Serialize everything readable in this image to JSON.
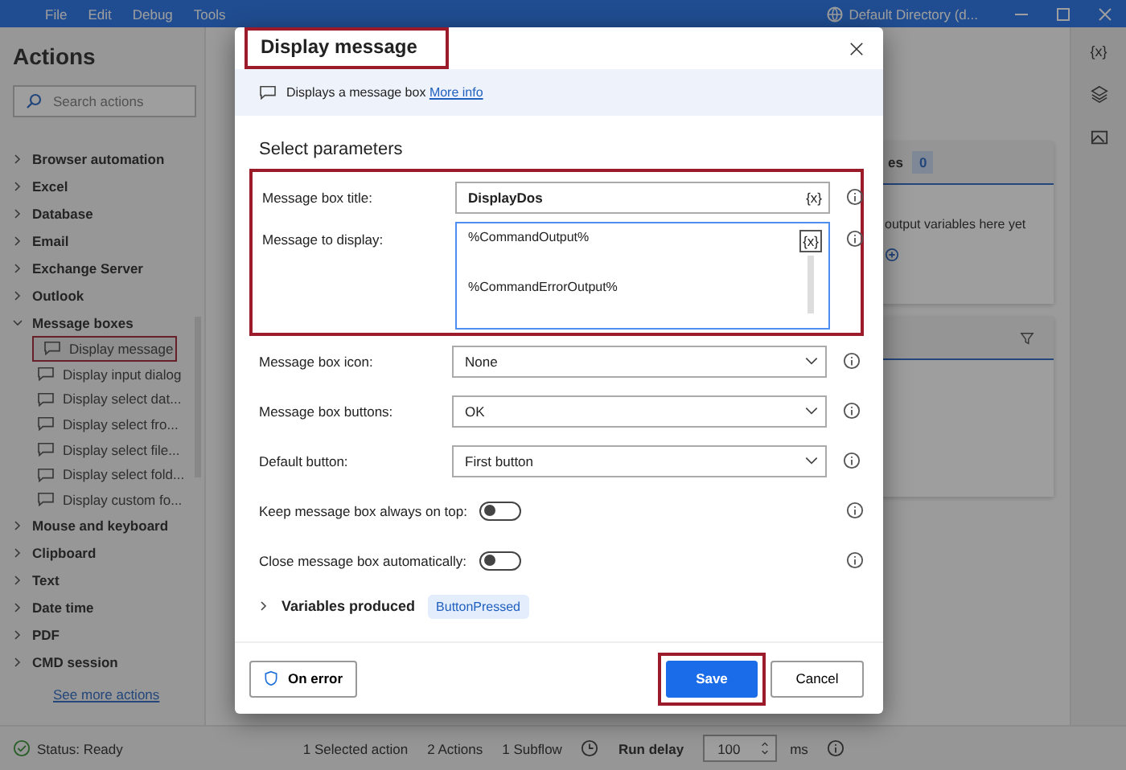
{
  "window": {
    "menu": [
      {
        "label": "File"
      },
      {
        "label": "Edit"
      },
      {
        "label": "Debug"
      },
      {
        "label": "Tools"
      }
    ],
    "account": "Default Directory (d..."
  },
  "actions_panel": {
    "title": "Actions",
    "search": {
      "placeholder": "Search actions"
    },
    "groups": [
      {
        "label": "Browser automation",
        "expanded": false
      },
      {
        "label": "Excel",
        "expanded": false
      },
      {
        "label": "Database",
        "expanded": false
      },
      {
        "label": "Email",
        "expanded": false
      },
      {
        "label": "Exchange Server",
        "expanded": false
      },
      {
        "label": "Outlook",
        "expanded": false
      },
      {
        "label": "Message boxes",
        "expanded": true,
        "children": [
          {
            "label": "Display message",
            "selected": true
          },
          {
            "label": "Display input dialog",
            "selected": false
          },
          {
            "label": "Display select dat...",
            "selected": false
          },
          {
            "label": "Display select fro...",
            "selected": false
          },
          {
            "label": "Display select file...",
            "selected": false
          },
          {
            "label": "Display select fold...",
            "selected": false
          },
          {
            "label": "Display custom fo...",
            "selected": false
          }
        ]
      },
      {
        "label": "Mouse and keyboard",
        "expanded": false
      },
      {
        "label": "Clipboard",
        "expanded": false
      },
      {
        "label": "Text",
        "expanded": false
      },
      {
        "label": "Date time",
        "expanded": false
      },
      {
        "label": "PDF",
        "expanded": false
      },
      {
        "label": "CMD session",
        "expanded": false
      }
    ],
    "more_link": "See more actions"
  },
  "variables_panel": {
    "header_fragment": "es",
    "count": "0",
    "empty_text": "output variables here yet"
  },
  "side_rail": {
    "variables_label": "{x}"
  },
  "dialog": {
    "title": "Display message",
    "title_highlighted": true,
    "description": "Displays a message box",
    "info_link": "More info",
    "section": "Select parameters",
    "fields": [
      {
        "kind": "text",
        "label": "Message box title:",
        "value": "DisplayDos",
        "var_button": "{x}",
        "highlighted": true
      },
      {
        "kind": "multiline",
        "label": "Message to display:",
        "lines": [
          "%CommandOutput%",
          "%CommandErrorOutput%"
        ],
        "var_button": "{x}",
        "highlighted": true
      },
      {
        "kind": "dropdown",
        "label": "Message box icon:",
        "value": "None",
        "highlighted": false
      },
      {
        "kind": "dropdown",
        "label": "Message box buttons:",
        "value": "OK",
        "highlighted": false
      },
      {
        "kind": "dropdown",
        "label": "Default button:",
        "value": "First button",
        "highlighted": false
      },
      {
        "kind": "toggle",
        "label": "Keep message box always on top:",
        "on": false,
        "highlighted": false
      },
      {
        "kind": "toggle",
        "label": "Close message box automatically:",
        "on": false,
        "highlighted": false
      }
    ],
    "variables": {
      "label": "Variables produced",
      "expanded": false,
      "chips": [
        "ButtonPressed"
      ]
    },
    "on_error": "On error",
    "save": {
      "label": "Save",
      "highlighted": true
    },
    "cancel": "Cancel"
  },
  "status_bar": {
    "status": "Status: Ready",
    "selected": "1 Selected action",
    "actions": "2 Actions",
    "subflows": "1 Subflow",
    "run_delay_label": "Run delay",
    "run_delay": "100",
    "unit": "ms"
  }
}
